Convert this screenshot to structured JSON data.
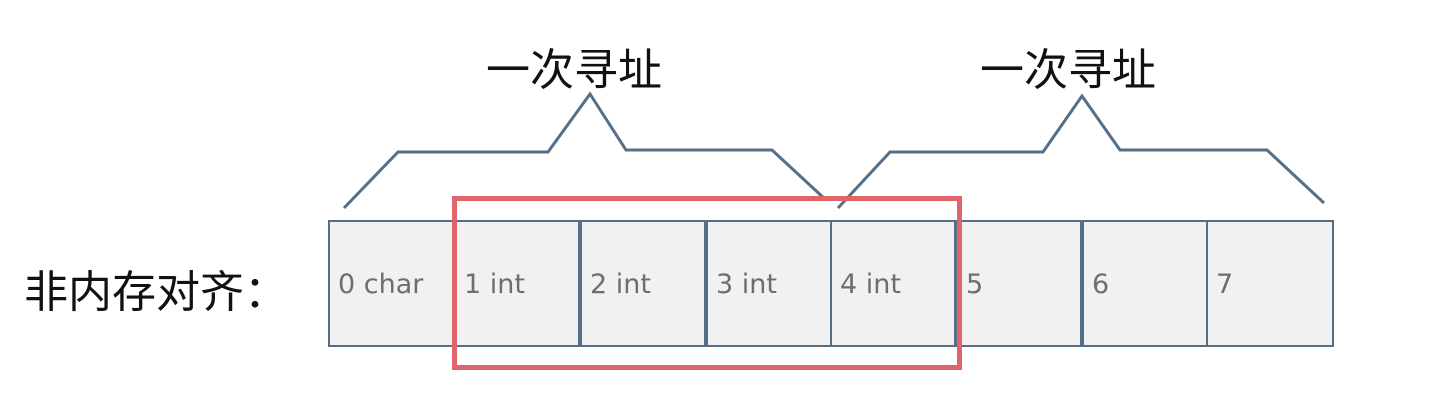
{
  "braces": [
    {
      "label": "一次寻址"
    },
    {
      "label": "一次寻址"
    }
  ],
  "row_label": "非内存对齐：",
  "cells": [
    {
      "label": "0 char"
    },
    {
      "label": "1 int"
    },
    {
      "label": "2 int"
    },
    {
      "label": "3 int"
    },
    {
      "label": "4 int"
    },
    {
      "label": "5"
    },
    {
      "label": "6"
    },
    {
      "label": "7"
    }
  ],
  "colors": {
    "cell_fill": "#f1f1f1",
    "cell_border": "#546f86",
    "brace_stroke": "#546f86",
    "highlight": "#e06468",
    "label_text": "#111111",
    "cell_text": "#6e6e6e"
  }
}
